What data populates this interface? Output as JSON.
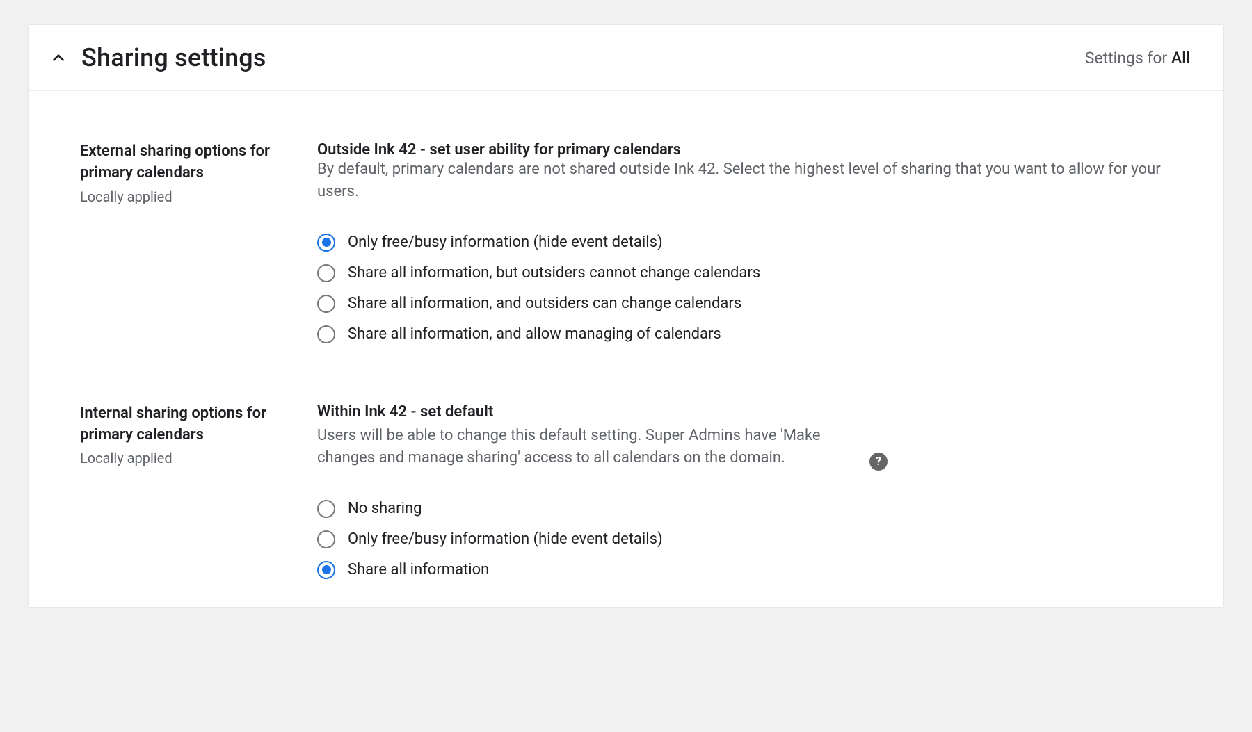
{
  "header": {
    "title": "Sharing settings",
    "settings_for_prefix": "Settings for ",
    "settings_for_scope": "All"
  },
  "sections": {
    "external": {
      "label_title": "External sharing options for primary calendars",
      "label_subtitle": "Locally applied",
      "heading": "Outside Ink 42 - set user ability for primary calendars",
      "description": "By default, primary calendars are not shared outside Ink 42. Select the highest level of sharing that you want to allow for your users.",
      "selected_index": 0,
      "options": [
        "Only free/busy information (hide event details)",
        "Share all information, but outsiders cannot change calendars",
        "Share all information, and outsiders can change calendars",
        "Share all information, and allow managing of calendars"
      ]
    },
    "internal": {
      "label_title": "Internal sharing options for primary calendars",
      "label_subtitle": "Locally applied",
      "heading": "Within Ink 42 - set default",
      "description": "Users will be able to change this default setting. Super Admins have 'Make changes and manage sharing' access to all calendars on the domain.",
      "selected_index": 2,
      "options": [
        "No sharing",
        "Only free/busy information (hide event details)",
        "Share all information"
      ]
    }
  }
}
